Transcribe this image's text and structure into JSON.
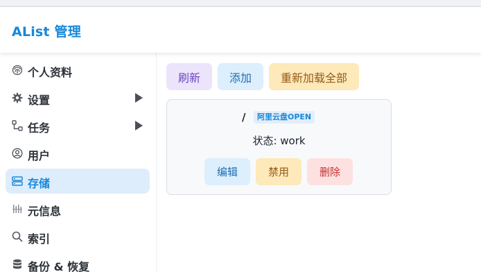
{
  "app": {
    "title": "AList 管理"
  },
  "sidebar": {
    "items": [
      {
        "label": "个人资料",
        "icon": "fingerprint-icon",
        "has_submenu": false,
        "active": false
      },
      {
        "label": "设置",
        "icon": "gear-icon",
        "has_submenu": true,
        "active": false
      },
      {
        "label": "任务",
        "icon": "task-flow-icon",
        "has_submenu": true,
        "active": false
      },
      {
        "label": "用户",
        "icon": "user-circle-icon",
        "has_submenu": false,
        "active": false
      },
      {
        "label": "存储",
        "icon": "storage-icon",
        "has_submenu": false,
        "active": true
      },
      {
        "label": "元信息",
        "icon": "metadata-icon",
        "has_submenu": false,
        "active": false
      },
      {
        "label": "索引",
        "icon": "search-icon",
        "has_submenu": false,
        "active": false
      },
      {
        "label": "备份 & 恢复",
        "icon": "database-icon",
        "has_submenu": false,
        "active": false
      }
    ]
  },
  "toolbar": {
    "refresh_label": "刷新",
    "add_label": "添加",
    "reload_all_label": "重新加载全部"
  },
  "storage_card": {
    "path": "/",
    "driver": "阿里云盘OPEN",
    "status": "状态: work",
    "edit_label": "编辑",
    "disable_label": "禁用",
    "delete_label": "删除"
  },
  "colors": {
    "accent": "#1788d8",
    "active_nav_bg": "#deedfb",
    "refresh_bg": "#ebe4fb",
    "add_bg": "#ddeefc",
    "reload_bg": "#fde9b9",
    "delete_bg": "#fde1e1"
  }
}
